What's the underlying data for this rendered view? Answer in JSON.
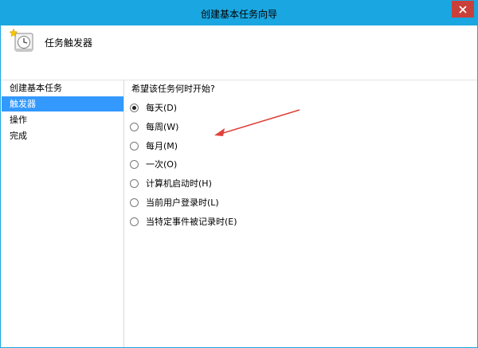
{
  "window": {
    "title": "创建基本任务向导"
  },
  "header": {
    "title": "任务触发器",
    "icon": "task-scheduler-clock-icon"
  },
  "sidebar": {
    "items": [
      {
        "label": "创建基本任务",
        "active": false
      },
      {
        "label": "触发器",
        "active": true
      },
      {
        "label": "操作",
        "active": false
      },
      {
        "label": "完成",
        "active": false
      }
    ]
  },
  "main": {
    "prompt": "希望该任务何时开始?",
    "options": [
      {
        "label": "每天(D)",
        "selected": true
      },
      {
        "label": "每周(W)",
        "selected": false
      },
      {
        "label": "每月(M)",
        "selected": false
      },
      {
        "label": "一次(O)",
        "selected": false
      },
      {
        "label": "计算机启动时(H)",
        "selected": false
      },
      {
        "label": "当前用户登录时(L)",
        "selected": false
      },
      {
        "label": "当特定事件被记录时(E)",
        "selected": false
      }
    ]
  },
  "colors": {
    "titlebar": "#1aa6e0",
    "close": "#c9403a",
    "selection": "#3399ff",
    "annotation": "#e0413a"
  }
}
